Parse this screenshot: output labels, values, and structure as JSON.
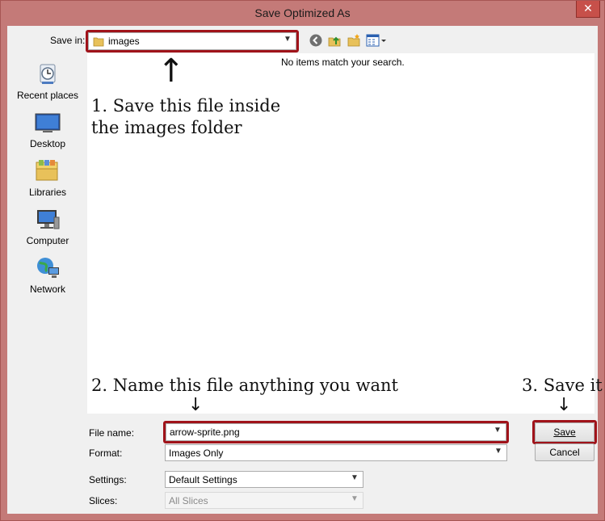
{
  "window": {
    "title": "Save Optimized As",
    "close_label": "✕"
  },
  "toolbar": {
    "save_in_label": "Save in:",
    "folder_value": "images"
  },
  "places": [
    {
      "label": "Recent places",
      "icon": "recent-places-icon"
    },
    {
      "label": "Desktop",
      "icon": "desktop-icon"
    },
    {
      "label": "Libraries",
      "icon": "libraries-icon"
    },
    {
      "label": "Computer",
      "icon": "computer-icon"
    },
    {
      "label": "Network",
      "icon": "network-icon"
    }
  ],
  "filelist": {
    "empty_message": "No items match your search."
  },
  "annotations": {
    "step1_line1": "1. Save this file inside",
    "step1_line2": "the images folder",
    "step2": "2. Name this file anything you want",
    "step3": "3. Save it",
    "arrow_up": "↑",
    "arrow_down": "↓"
  },
  "form": {
    "file_name_label": "File name:",
    "file_name_value": "arrow-sprite.png",
    "format_label": "Format:",
    "format_value": "Images Only",
    "settings_label": "Settings:",
    "settings_value": "Default Settings",
    "slices_label": "Slices:",
    "slices_value": "All Slices"
  },
  "buttons": {
    "save_label": "Save",
    "cancel_label": "Cancel"
  },
  "colors": {
    "highlight": "#a0131a",
    "frame": "#c47a78",
    "close": "#c7504a"
  }
}
